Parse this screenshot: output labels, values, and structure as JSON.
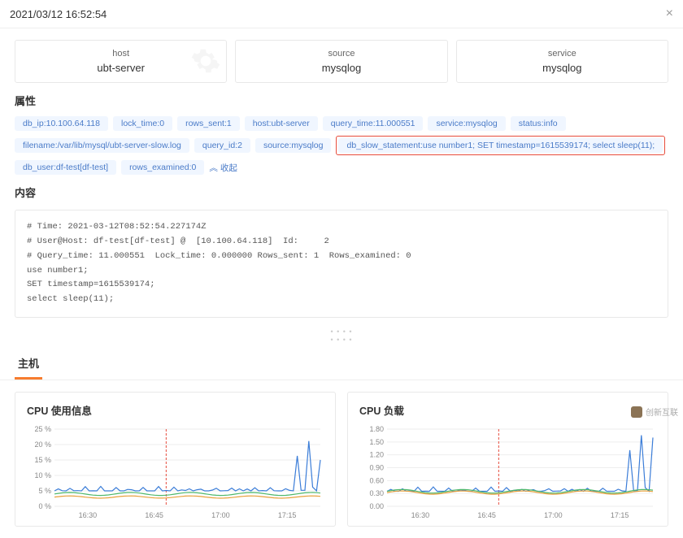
{
  "header": {
    "timestamp": "2021/03/12 16:52:54"
  },
  "info_cards": [
    {
      "label": "host",
      "value": "ubt-server"
    },
    {
      "label": "source",
      "value": "mysqlog"
    },
    {
      "label": "service",
      "value": "mysqlog"
    }
  ],
  "sections": {
    "attrs_title": "属性",
    "content_title": "内容",
    "host_tab": "主机"
  },
  "tags_row1": [
    "db_ip:10.100.64.118",
    "lock_time:0",
    "rows_sent:1",
    "host:ubt-server",
    "query_time:11.000551",
    "service:mysqlog",
    "status:info",
    "filename:/var/lib/mysql/ubt-server-slow.log"
  ],
  "tags_row2_pre": [
    "query_id:2",
    "source:mysqlog"
  ],
  "tag_highlighted": "db_slow_statement:use number1; SET timestamp=1615539174; select sleep(11);",
  "tags_row2_post": [
    "db_user:df-test[df-test]",
    "rows_examined:0"
  ],
  "collapse_label": "收起",
  "content_text": "# Time: 2021-03-12T08:52:54.227174Z\n# User@Host: df-test[df-test] @  [10.100.64.118]  Id:     2\n# Query_time: 11.000551  Lock_time: 0.000000 Rows_sent: 1  Rows_examined: 0\nuse number1;\nSET timestamp=1615539174;\nselect sleep(11);",
  "chart_data": [
    {
      "type": "line",
      "title": "CPU 使用信息",
      "ylabel": "",
      "ylim": [
        0,
        25
      ],
      "y_ticks": [
        "25 %",
        "20 %",
        "15 %",
        "10 %",
        "5 %",
        "0 %"
      ],
      "x_ticks": [
        "16:30",
        "16:45",
        "17:00",
        "17:15"
      ],
      "marker_x": 0.42,
      "series": [
        {
          "name": "blue",
          "color": "#3b7dd8",
          "baseline": 5,
          "spike": 22,
          "jitter": true
        },
        {
          "name": "green",
          "color": "#4fb86b",
          "baseline": 4,
          "spike": 0,
          "jitter": false
        },
        {
          "name": "orange",
          "color": "#e8a03c",
          "baseline": 3,
          "spike": 0,
          "jitter": false
        }
      ]
    },
    {
      "type": "line",
      "title": "CPU 负载",
      "ylabel": "",
      "ylim": [
        0,
        1.8
      ],
      "y_ticks": [
        "1.80",
        "1.50",
        "1.20",
        "0.90",
        "0.60",
        "0.30",
        "0.00"
      ],
      "x_ticks": [
        "16:30",
        "16:45",
        "17:00",
        "17:15"
      ],
      "marker_x": 0.42,
      "series": [
        {
          "name": "blue",
          "color": "#3b7dd8",
          "baseline": 0.35,
          "spike": 1.7,
          "jitter": true
        },
        {
          "name": "green",
          "color": "#4fb86b",
          "baseline": 0.35,
          "spike": 0,
          "jitter": false
        },
        {
          "name": "orange",
          "color": "#e8a03c",
          "baseline": 0.32,
          "spike": 0,
          "jitter": false
        }
      ]
    }
  ],
  "watermark": "创新互联"
}
